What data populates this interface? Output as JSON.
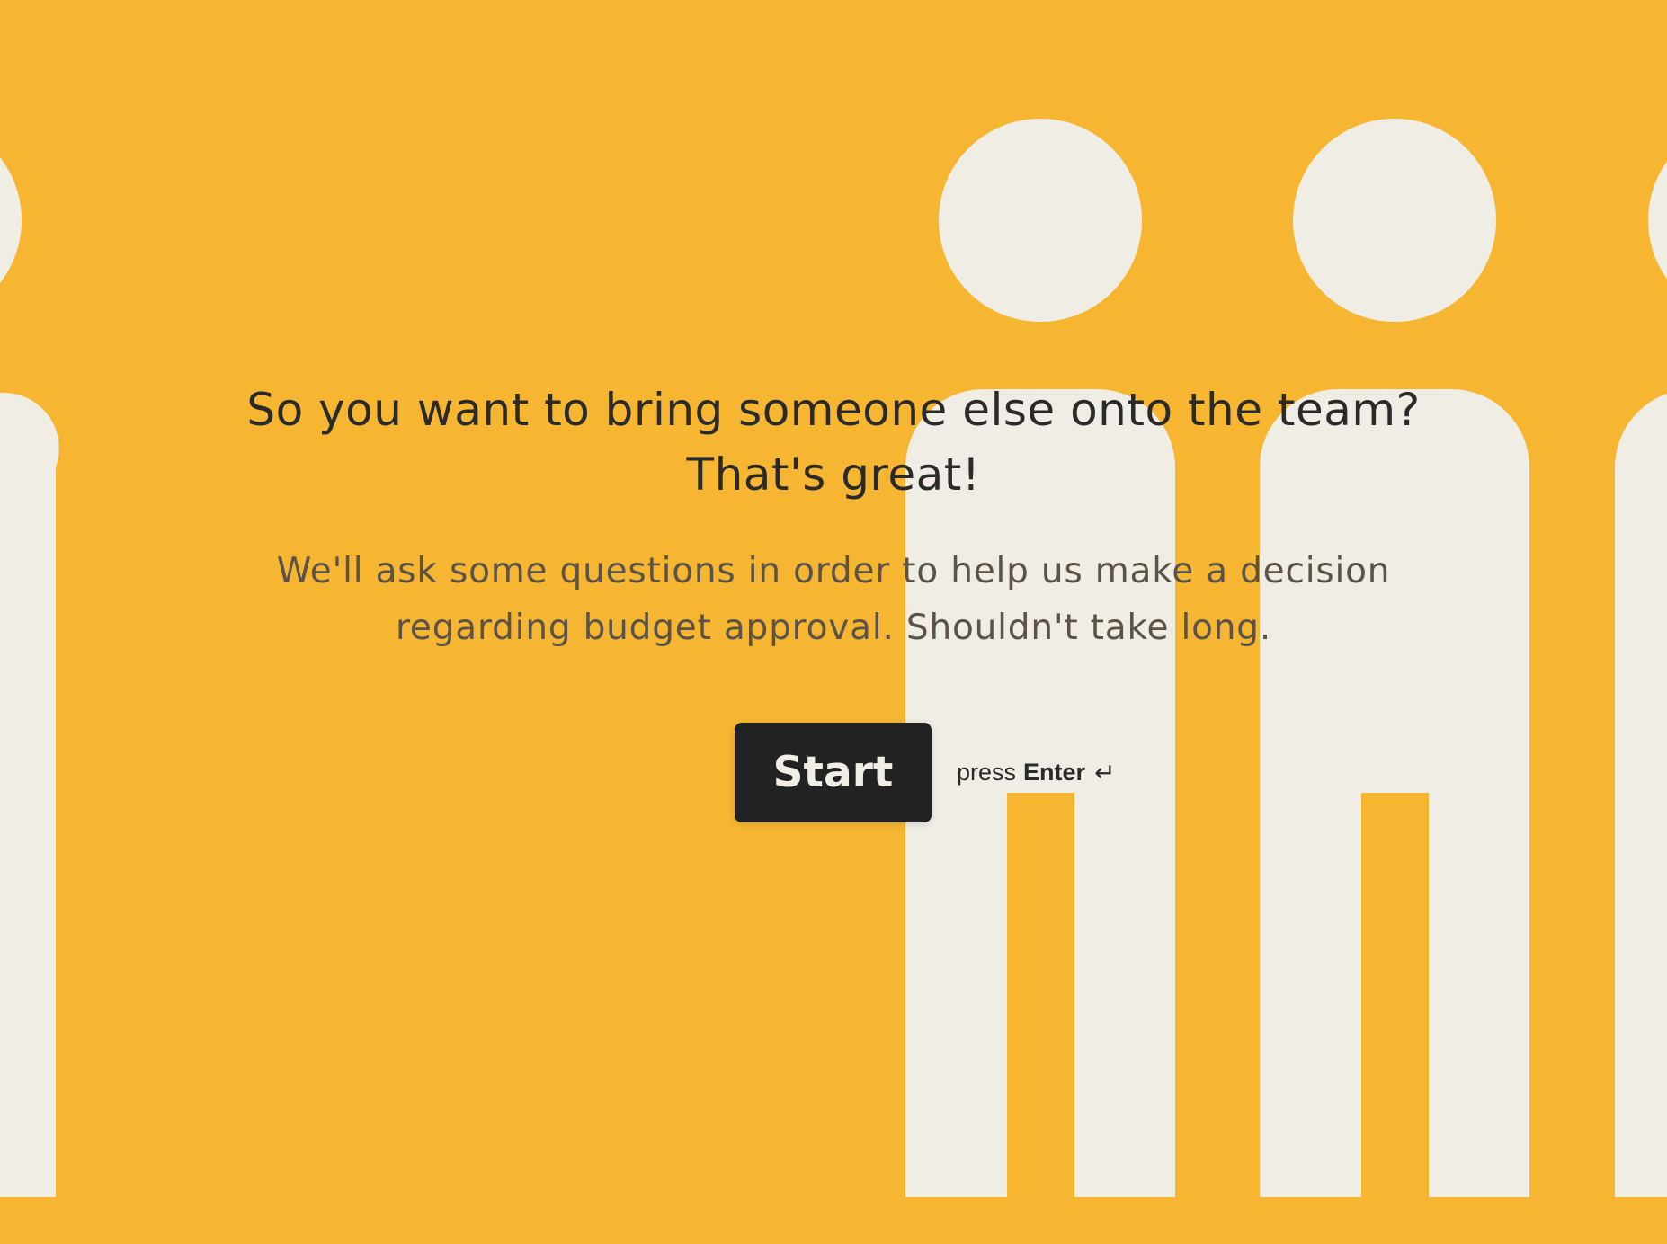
{
  "theme": {
    "background_color": "#F6B632",
    "figure_color": "#F0EDE4",
    "text_primary": "#2a2a2a",
    "text_secondary": "#5b5348",
    "button_color": "#222222",
    "button_text_color": "#f1eee5"
  },
  "welcome": {
    "title_line_1": "So you want to bring someone else onto the team?",
    "title_line_2": "That's great!",
    "description_line_1": "We'll ask some questions in order to help us make a decision",
    "description_line_2": "regarding budget approval. Shouldn't take long."
  },
  "actions": {
    "start_label": "Start",
    "hint_prefix": "press",
    "hint_key": "Enter",
    "hint_icon": "return-key-icon",
    "hint_glyph": "↵"
  }
}
